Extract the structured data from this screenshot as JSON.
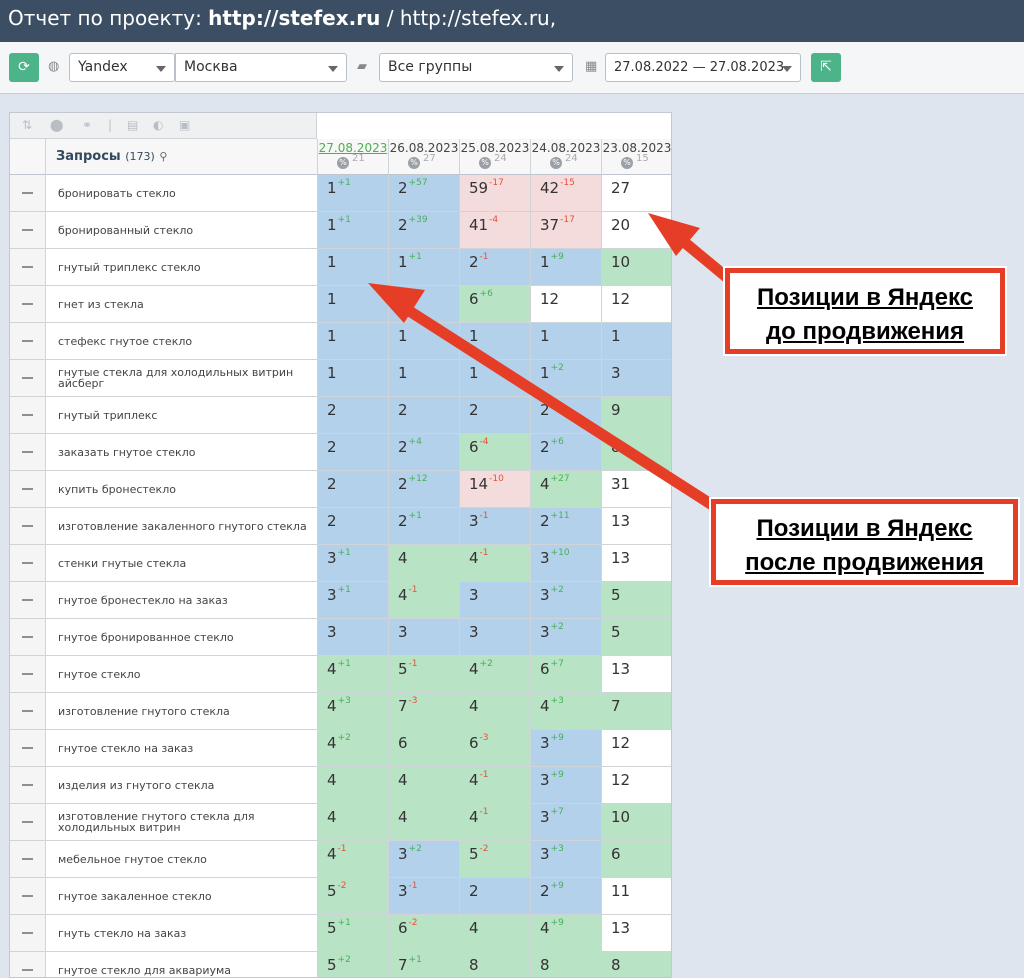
{
  "header": {
    "title_prefix": "Отчет по проекту: ",
    "title_domain": "http://stefex.ru",
    "title_suffix": " / http://stefex.ru,"
  },
  "toolbar": {
    "engine": "Yandex",
    "region": "Москва",
    "group": "Все группы",
    "daterange": "27.08.2022 — 27.08.2023"
  },
  "table": {
    "queries_label": "Запросы",
    "queries_count": "(173)",
    "dates": [
      {
        "date": "27.08.2023",
        "num": "21"
      },
      {
        "date": "26.08.2023",
        "num": "27"
      },
      {
        "date": "25.08.2023",
        "num": "24"
      },
      {
        "date": "24.08.2023",
        "num": "24"
      },
      {
        "date": "23.08.2023",
        "num": "15"
      }
    ],
    "rows": [
      {
        "q": "бронировать стекло",
        "cells": [
          [
            "1",
            "+1",
            "b"
          ],
          [
            "2",
            "+57",
            "b"
          ],
          [
            "59",
            "-17",
            "r"
          ],
          [
            "42",
            "-15",
            "r"
          ],
          [
            "27",
            "",
            "w"
          ]
        ]
      },
      {
        "q": "бронированный стекло",
        "cells": [
          [
            "1",
            "+1",
            "b"
          ],
          [
            "2",
            "+39",
            "b"
          ],
          [
            "41",
            "-4",
            "r"
          ],
          [
            "37",
            "-17",
            "r"
          ],
          [
            "20",
            "",
            "w"
          ]
        ]
      },
      {
        "q": "гнутый триплекс стекло",
        "cells": [
          [
            "1",
            "",
            "b"
          ],
          [
            "1",
            "+1",
            "b"
          ],
          [
            "2",
            "-1",
            "b"
          ],
          [
            "1",
            "+9",
            "b"
          ],
          [
            "10",
            "",
            "g"
          ]
        ]
      },
      {
        "q": "гнет из стекла",
        "cells": [
          [
            "1",
            "",
            "b"
          ],
          [
            "",
            "",
            "b"
          ],
          [
            "6",
            "+6",
            "g"
          ],
          [
            "12",
            "",
            "w"
          ],
          [
            "12",
            "",
            "w"
          ]
        ]
      },
      {
        "q": "стефекс гнутое стекло",
        "cells": [
          [
            "1",
            "",
            "b"
          ],
          [
            "1",
            "",
            "b"
          ],
          [
            "1",
            "",
            "b"
          ],
          [
            "1",
            "",
            "b"
          ],
          [
            "1",
            "",
            "b"
          ]
        ]
      },
      {
        "q": "гнутые стекла для холодильных витрин айсберг",
        "cells": [
          [
            "1",
            "",
            "b"
          ],
          [
            "1",
            "",
            "b"
          ],
          [
            "1",
            "",
            "b"
          ],
          [
            "1",
            "+2",
            "b"
          ],
          [
            "3",
            "",
            "b"
          ]
        ]
      },
      {
        "q": "гнутый триплекс",
        "cells": [
          [
            "2",
            "",
            "b"
          ],
          [
            "2",
            "",
            "b"
          ],
          [
            "2",
            "",
            "b"
          ],
          [
            "2",
            "",
            "b"
          ],
          [
            "9",
            "",
            "g"
          ]
        ]
      },
      {
        "q": "заказать гнутое стекло",
        "cells": [
          [
            "2",
            "",
            "b"
          ],
          [
            "2",
            "+4",
            "b"
          ],
          [
            "6",
            "-4",
            "g"
          ],
          [
            "2",
            "+6",
            "b"
          ],
          [
            "8",
            "",
            "g"
          ]
        ]
      },
      {
        "q": "купить бронестекло",
        "cells": [
          [
            "2",
            "",
            "b"
          ],
          [
            "2",
            "+12",
            "b"
          ],
          [
            "14",
            "-10",
            "r"
          ],
          [
            "4",
            "+27",
            "g"
          ],
          [
            "31",
            "",
            "w"
          ]
        ]
      },
      {
        "q": "изготовление закаленного гнутого стекла",
        "cells": [
          [
            "2",
            "",
            "b"
          ],
          [
            "2",
            "+1",
            "b"
          ],
          [
            "3",
            "-1",
            "b"
          ],
          [
            "2",
            "+11",
            "b"
          ],
          [
            "13",
            "",
            "w"
          ]
        ]
      },
      {
        "q": "стенки гнутые стекла",
        "cells": [
          [
            "3",
            "+1",
            "b"
          ],
          [
            "4",
            "",
            "g"
          ],
          [
            "4",
            "-1",
            "g"
          ],
          [
            "3",
            "+10",
            "b"
          ],
          [
            "13",
            "",
            "w"
          ]
        ]
      },
      {
        "q": "гнутое бронестекло на заказ",
        "cells": [
          [
            "3",
            "+1",
            "b"
          ],
          [
            "4",
            "-1",
            "g"
          ],
          [
            "3",
            "",
            "b"
          ],
          [
            "3",
            "+2",
            "b"
          ],
          [
            "5",
            "",
            "g"
          ]
        ]
      },
      {
        "q": "гнутое бронированное стекло",
        "cells": [
          [
            "3",
            "",
            "b"
          ],
          [
            "3",
            "",
            "b"
          ],
          [
            "3",
            "",
            "b"
          ],
          [
            "3",
            "+2",
            "b"
          ],
          [
            "5",
            "",
            "g"
          ]
        ]
      },
      {
        "q": "гнутое стекло",
        "cells": [
          [
            "4",
            "+1",
            "g"
          ],
          [
            "5",
            "-1",
            "g"
          ],
          [
            "4",
            "+2",
            "g"
          ],
          [
            "6",
            "+7",
            "g"
          ],
          [
            "13",
            "",
            "w"
          ]
        ]
      },
      {
        "q": "изготовление гнутого стекла",
        "cells": [
          [
            "4",
            "+3",
            "g"
          ],
          [
            "7",
            "-3",
            "g"
          ],
          [
            "4",
            "",
            "g"
          ],
          [
            "4",
            "+3",
            "g"
          ],
          [
            "7",
            "",
            "g"
          ]
        ]
      },
      {
        "q": "гнутое стекло на заказ",
        "cells": [
          [
            "4",
            "+2",
            "g"
          ],
          [
            "6",
            "",
            "g"
          ],
          [
            "6",
            "-3",
            "g"
          ],
          [
            "3",
            "+9",
            "b"
          ],
          [
            "12",
            "",
            "w"
          ]
        ]
      },
      {
        "q": "изделия из гнутого стекла",
        "cells": [
          [
            "4",
            "",
            "g"
          ],
          [
            "4",
            "",
            "g"
          ],
          [
            "4",
            "-1",
            "g"
          ],
          [
            "3",
            "+9",
            "b"
          ],
          [
            "12",
            "",
            "w"
          ]
        ]
      },
      {
        "q": "изготовление гнутого стекла для холодильных витрин",
        "cells": [
          [
            "4",
            "",
            "g"
          ],
          [
            "4",
            "",
            "g"
          ],
          [
            "4",
            "-1",
            "g"
          ],
          [
            "3",
            "+7",
            "b"
          ],
          [
            "10",
            "",
            "g"
          ]
        ]
      },
      {
        "q": "мебельное гнутое стекло",
        "cells": [
          [
            "4",
            "-1",
            "g"
          ],
          [
            "3",
            "+2",
            "b"
          ],
          [
            "5",
            "-2",
            "g"
          ],
          [
            "3",
            "+3",
            "b"
          ],
          [
            "6",
            "",
            "g"
          ]
        ]
      },
      {
        "q": "гнутое закаленное стекло",
        "cells": [
          [
            "5",
            "-2",
            "g"
          ],
          [
            "3",
            "-1",
            "b"
          ],
          [
            "2",
            "",
            "b"
          ],
          [
            "2",
            "+9",
            "b"
          ],
          [
            "11",
            "",
            "w"
          ]
        ]
      },
      {
        "q": "гнуть стекло на заказ",
        "cells": [
          [
            "5",
            "+1",
            "g"
          ],
          [
            "6",
            "-2",
            "g"
          ],
          [
            "4",
            "",
            "g"
          ],
          [
            "4",
            "+9",
            "g"
          ],
          [
            "13",
            "",
            "w"
          ]
        ]
      },
      {
        "q": "гнутое стекло для аквариума",
        "cells": [
          [
            "5",
            "+2",
            "g"
          ],
          [
            "7",
            "+1",
            "g"
          ],
          [
            "8",
            "",
            "g"
          ],
          [
            "8",
            "",
            "g"
          ],
          [
            "8",
            "",
            "g"
          ]
        ]
      }
    ]
  },
  "annotations": {
    "before_line1": "Позиции в Яндекс",
    "before_line2": "до продвижения",
    "after_line1": "Позиции в Яндекс",
    "after_line2": "после продвижения",
    "arrow_color": "#e53d26"
  }
}
